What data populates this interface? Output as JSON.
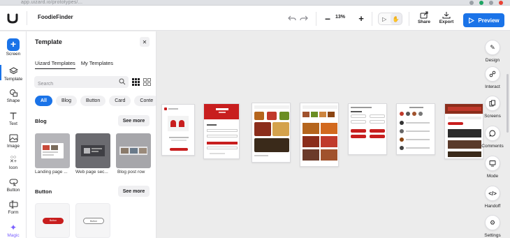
{
  "browser": {
    "url": "app.uizard.io/prototypes/..."
  },
  "topbar": {
    "project_name": "FoodieFinder",
    "zoom": "13%",
    "share_label": "Share",
    "export_label": "Export",
    "preview_label": "Preview"
  },
  "left_rail": {
    "items": [
      {
        "label": "Screen",
        "icon": "plus-icon"
      },
      {
        "label": "Template",
        "icon": "layers-icon"
      },
      {
        "label": "Shape",
        "icon": "shapes-icon"
      },
      {
        "label": "Text",
        "icon": "text-icon"
      },
      {
        "label": "Image",
        "icon": "image-icon"
      },
      {
        "label": "Icon",
        "icon": "icon-grid-icon"
      },
      {
        "label": "Button",
        "icon": "button-icon"
      },
      {
        "label": "Form",
        "icon": "form-icon"
      },
      {
        "label": "Magic",
        "icon": "magic-icon"
      }
    ]
  },
  "panel": {
    "title": "Template",
    "tabs": [
      {
        "label": "Uizard Templates",
        "active": true
      },
      {
        "label": "My Templates",
        "active": false
      }
    ],
    "search_placeholder": "Search",
    "chips": [
      "All",
      "Blog",
      "Button",
      "Card",
      "Conte"
    ],
    "blog": {
      "title": "Blog",
      "see_more": "See more",
      "items": [
        "Landing page ...",
        "Web page sec...",
        "Blog post row"
      ]
    },
    "button": {
      "title": "Button",
      "see_more": "See more",
      "primary_label": "Button",
      "secondary_label": "Button"
    }
  },
  "right_rail": {
    "items": [
      "Design",
      "Interact",
      "Screens",
      "Comments",
      "Mode",
      "Handoff",
      "Settings"
    ]
  },
  "colors": {
    "accent": "#1a73e8",
    "brand_red": "#c81e1e",
    "magic": "#7b61ff"
  }
}
